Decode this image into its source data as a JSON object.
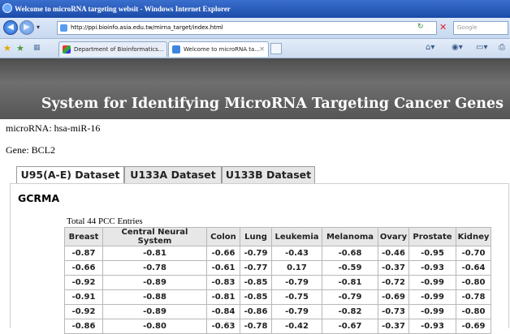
{
  "window": {
    "title": "Welcome to microRNA targeting websit - Windows Internet Explorer"
  },
  "address_bar": {
    "url": "http://ppi.bioinfo.asia.edu.tw/mirna_target/index.html",
    "search_placeholder": "Google"
  },
  "browser_tabs": [
    {
      "label": "Department of Bioinformatics..."
    },
    {
      "label": "Welcome to microRNA ta...",
      "close": "✕"
    }
  ],
  "banner": {
    "title": "System for Identifying MicroRNA Targeting Cancer Genes"
  },
  "info": {
    "microrna": "microRNA: hsa-miR-16",
    "gene": "Gene: BCL2"
  },
  "dataset_tabs": [
    {
      "label": "U95(A-E) Dataset",
      "active": true
    },
    {
      "label": "U133A Dataset",
      "active": false
    },
    {
      "label": "U133B Dataset",
      "active": false
    }
  ],
  "section": {
    "title": "GCRMA",
    "total": "Total 44 PCC Entries"
  },
  "table": {
    "headers": [
      "Breast",
      "Central Neural System",
      "Colon",
      "Lung",
      "Leukemia",
      "Melanoma",
      "Ovary",
      "Prostate",
      "Kidney"
    ],
    "rows": [
      [
        "-0.87",
        "-0.81",
        "-0.66",
        "-0.79",
        "-0.43",
        "-0.68",
        "-0.46",
        "-0.95",
        "-0.70"
      ],
      [
        "-0.66",
        "-0.78",
        "-0.61",
        "-0.77",
        "0.17",
        "-0.59",
        "-0.37",
        "-0.93",
        "-0.64"
      ],
      [
        "-0.92",
        "-0.89",
        "-0.83",
        "-0.85",
        "-0.79",
        "-0.81",
        "-0.72",
        "-0.99",
        "-0.80"
      ],
      [
        "-0.91",
        "-0.88",
        "-0.81",
        "-0.85",
        "-0.75",
        "-0.79",
        "-0.69",
        "-0.99",
        "-0.78"
      ],
      [
        "-0.92",
        "-0.89",
        "-0.84",
        "-0.86",
        "-0.79",
        "-0.82",
        "-0.73",
        "-0.99",
        "-0.80"
      ],
      [
        "-0.86",
        "-0.80",
        "-0.63",
        "-0.78",
        "-0.42",
        "-0.67",
        "-0.37",
        "-0.93",
        "-0.69"
      ]
    ]
  }
}
